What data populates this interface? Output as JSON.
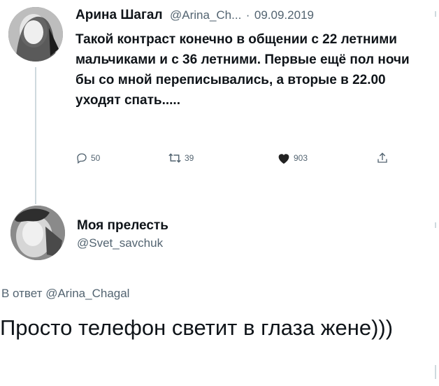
{
  "tweet1": {
    "display_name": "Арина Шагал",
    "handle": "@Arina_Ch...",
    "separator": "·",
    "date": "09.09.2019",
    "text": "Такой контраст конечно в общении с 22 летними мальчиками и с 36 летними. Первые ещё пол ночи бы со мной переписывались, а вторые в 22.00 уходят спать.....",
    "actions": {
      "replies": "50",
      "retweets": "39",
      "likes": "903"
    },
    "icons": [
      "reply-icon",
      "retweet-icon",
      "heart-icon",
      "share-icon"
    ]
  },
  "tweet2": {
    "display_name": "Моя прелесть",
    "handle": "@Svet_savchuk",
    "reply_prefix": "В ответ",
    "reply_handle": "@Arina_Chagal",
    "text": "Просто телефон светит в глаза жене)))"
  },
  "colors": {
    "text": "#0f1419",
    "muted": "#536471",
    "thread_line": "#cfd9de",
    "like": "#222222"
  }
}
